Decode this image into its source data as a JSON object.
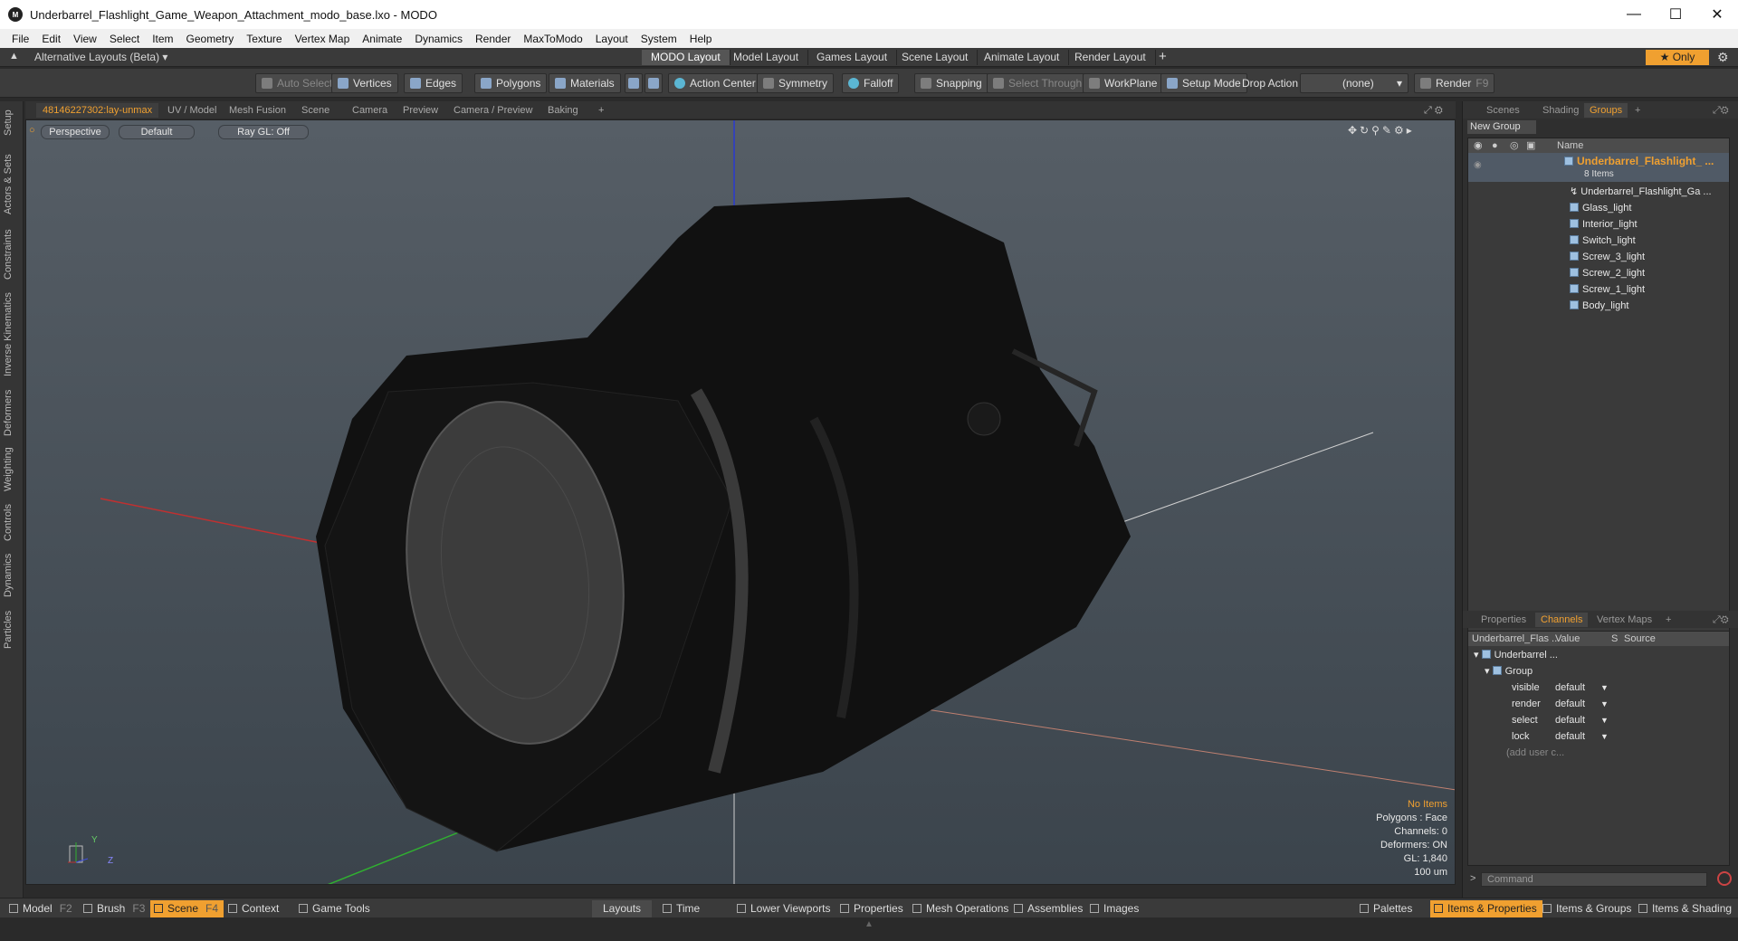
{
  "window": {
    "title": "Underbarrel_Flashlight_Game_Weapon_Attachment_modo_base.lxo - MODO",
    "icon": "modo-app-icon"
  },
  "menu": [
    "File",
    "Edit",
    "View",
    "Select",
    "Item",
    "Geometry",
    "Texture",
    "Vertex Map",
    "Animate",
    "Dynamics",
    "Render",
    "MaxToModo",
    "Layout",
    "System",
    "Help"
  ],
  "layouts": {
    "selector": "Alternative Layouts (Beta)",
    "tabs": [
      "MODO Layout",
      "Model Layout",
      "Games Layout",
      "Scene Layout",
      "Animate Layout",
      "Render Layout"
    ],
    "active": "MODO Layout",
    "only": "Only"
  },
  "toolbar": {
    "auto_select": "Auto Select",
    "vertices": "Vertices",
    "edges": "Edges",
    "polygons": "Polygons",
    "materials": "Materials",
    "action_center": "Action Center",
    "symmetry": "Symmetry",
    "falloff": "Falloff",
    "snapping": "Snapping",
    "select_through": "Select Through",
    "workplane": "WorkPlane",
    "setup_mode": "Setup Mode",
    "drop_action": "Drop Action",
    "drop_value": "(none)",
    "render": "Render",
    "render_key": "F9"
  },
  "viewport_tabs": [
    "48146227302:lay-unmax",
    "UV / Model",
    "Mesh Fusion",
    "Scene",
    "Camera",
    "Preview",
    "Camera / Preview",
    "Baking"
  ],
  "left_tabs": [
    "Setup",
    "Actors & Sets",
    "Constraints",
    "Inverse Kinematics",
    "Deformers",
    "Weighting",
    "Controls",
    "Dynamics",
    "Particles"
  ],
  "viewport": {
    "view": "Perspective",
    "shading": "Default",
    "raygl": "Ray GL: Off",
    "info": {
      "items": "No Items",
      "polygons": "Polygons : Face",
      "channels": "Channels: 0",
      "deformers": "Deformers: ON",
      "gl": "GL: 1,840",
      "scale": "100 um"
    },
    "axis": {
      "y": "Y",
      "z": "Z"
    }
  },
  "right_panel": {
    "top_tabs": [
      "Scenes",
      "Shading",
      "Groups"
    ],
    "active_top": "Groups",
    "new_group": "New Group",
    "col_name": "Name",
    "group": {
      "name": "Underbarrel_Flashlight_ ...",
      "count": "8 Items"
    },
    "items": [
      "Underbarrel_Flashlight_Ga ...",
      "Glass_light",
      "Interior_light",
      "Switch_light",
      "Screw_3_light",
      "Screw_2_light",
      "Screw_1_light",
      "Body_light"
    ],
    "bottom_tabs": [
      "Properties",
      "Channels",
      "Vertex Maps"
    ],
    "active_bottom": "Channels",
    "channels": {
      "col1": "Underbarrel_Flas ...",
      "col2": "Value",
      "col3": "S",
      "col4": "Source",
      "item": "Underbarrel ...",
      "group": "Group",
      "rows": [
        {
          "name": "visible",
          "value": "default"
        },
        {
          "name": "render",
          "value": "default"
        },
        {
          "name": "select",
          "value": "default"
        },
        {
          "name": "lock",
          "value": "default"
        }
      ],
      "add": "(add user c..."
    },
    "command_placeholder": "Command"
  },
  "bottom": {
    "left": [
      {
        "label": "Model",
        "key": "F2"
      },
      {
        "label": "Brush",
        "key": "F3"
      },
      {
        "label": "Scene",
        "key": "F4"
      },
      {
        "label": "Context",
        "key": ""
      },
      {
        "label": "Game Tools",
        "key": ""
      }
    ],
    "mid": [
      "Layouts",
      "Time",
      "Lower Viewports",
      "Properties",
      "Mesh Operations",
      "Assemblies",
      "Images"
    ],
    "right": [
      "Palettes",
      "Items & Properties",
      "Items & Groups",
      "Items & Shading"
    ]
  },
  "colors": {
    "accent": "#f0a030",
    "viewport_top": "#565e66",
    "viewport_bottom": "#3b444c"
  }
}
